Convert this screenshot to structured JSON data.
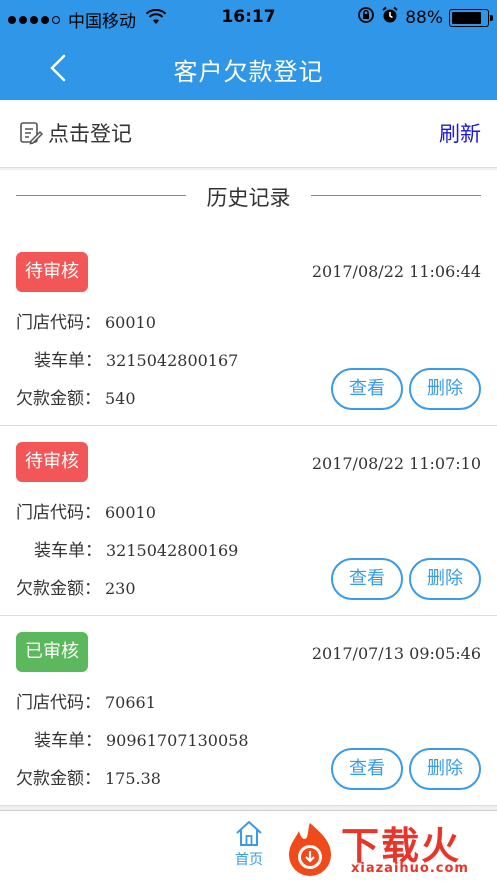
{
  "status_bar": {
    "carrier": "中国移动",
    "time": "16:17",
    "battery": "88%",
    "battery_level": 0.88
  },
  "nav": {
    "title": "客户欠款登记"
  },
  "actions": {
    "register_label": "点击登记",
    "refresh_label": "刷新"
  },
  "history": {
    "title": "历史记录"
  },
  "labels": {
    "store_code": "门店代码：",
    "loading_order": "装车单：",
    "debt_amount": "欠款金额：",
    "view": "查看",
    "delete": "删除"
  },
  "records": [
    {
      "status": "待审核",
      "status_color": "#f25656",
      "datetime": "2017/08/22 11:06:44",
      "store_code": "60010",
      "loading_order": "3215042800167",
      "debt_amount": "540"
    },
    {
      "status": "待审核",
      "status_color": "#f25656",
      "datetime": "2017/08/22 11:07:10",
      "store_code": "60010",
      "loading_order": "3215042800169",
      "debt_amount": "230"
    },
    {
      "status": "已审核",
      "status_color": "#5cb85c",
      "datetime": "2017/07/13 09:05:46",
      "store_code": "70661",
      "loading_order": "90961707130058",
      "debt_amount": "175.38"
    }
  ],
  "tab_bar": {
    "home_label": "首页"
  },
  "watermark": {
    "brand": "下载火",
    "domain": "xiazaihuo.com"
  },
  "colors": {
    "primary": "#2f96e8",
    "accent_button": "#3a9be6",
    "pending": "#f25656",
    "approved": "#5cb85c",
    "refresh_link": "#1a1adb"
  }
}
